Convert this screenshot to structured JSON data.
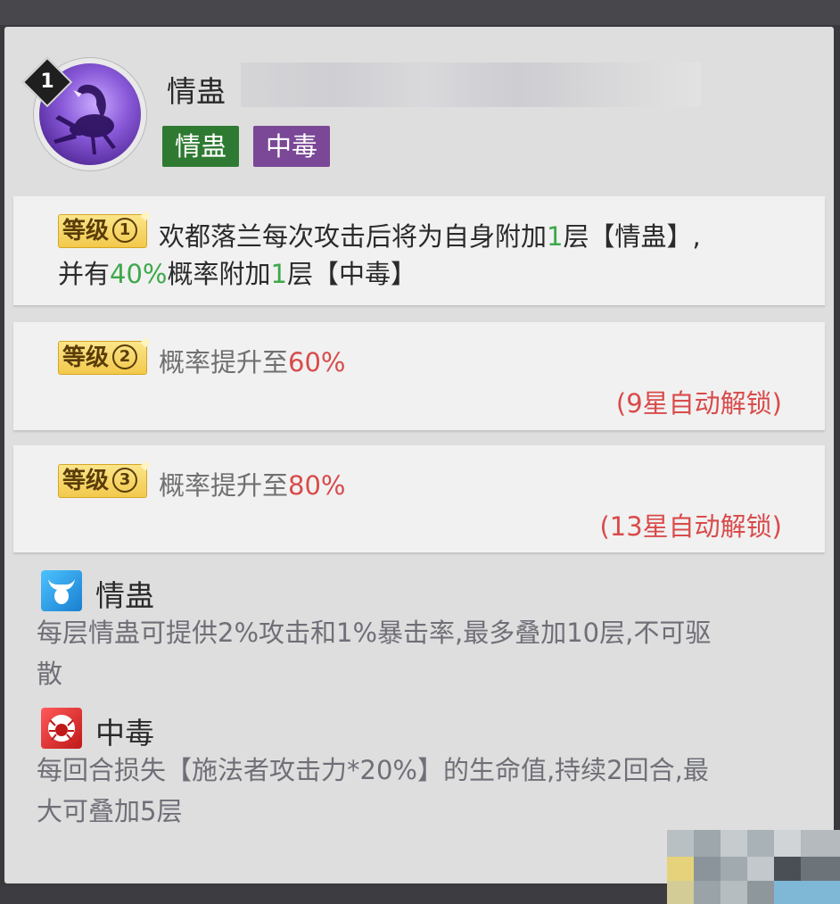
{
  "skill": {
    "level": "1",
    "name": "情蛊",
    "tags": [
      "情蛊",
      "中毒"
    ],
    "icon": "scorpion-icon"
  },
  "levels": [
    {
      "badge_text": "等级",
      "badge_num": "1",
      "desc": [
        {
          "text": "欢都落兰每次攻击后将为自身附加"
        },
        {
          "text": "1",
          "color": "green"
        },
        {
          "text": "层【情蛊】,"
        }
      ],
      "desc_line2": [
        {
          "text": "并有"
        },
        {
          "text": "40%",
          "color": "green"
        },
        {
          "text": "概率附加"
        },
        {
          "text": "1",
          "color": "green"
        },
        {
          "text": "层【中毒】"
        }
      ]
    },
    {
      "badge_text": "等级",
      "badge_num": "2",
      "desc_prefix": "概率提升至",
      "desc_value": "60%",
      "unlock": "(9星自动解锁)"
    },
    {
      "badge_text": "等级",
      "badge_num": "3",
      "desc_prefix": "概率提升至",
      "desc_value": "80%",
      "unlock": "(13星自动解锁)"
    }
  ],
  "buffs": [
    {
      "icon": "bull-icon",
      "name": "情蛊",
      "desc_line1": "每层情蛊可提供2%攻击和1%暴击率,最多叠加10层,不可驱",
      "desc_line2": "散"
    },
    {
      "icon": "spider-icon",
      "name": "中毒",
      "desc_line1": "每回合损失【施法者攻击力*20%】的生命值,持续2回合,最",
      "desc_line2": "大可叠加5层"
    }
  ],
  "colors": {
    "green_tag": "#2f7a32",
    "purple_tag": "#7a4896",
    "highlight_green": "#3ea84a",
    "highlight_red": "#d94b4b"
  }
}
